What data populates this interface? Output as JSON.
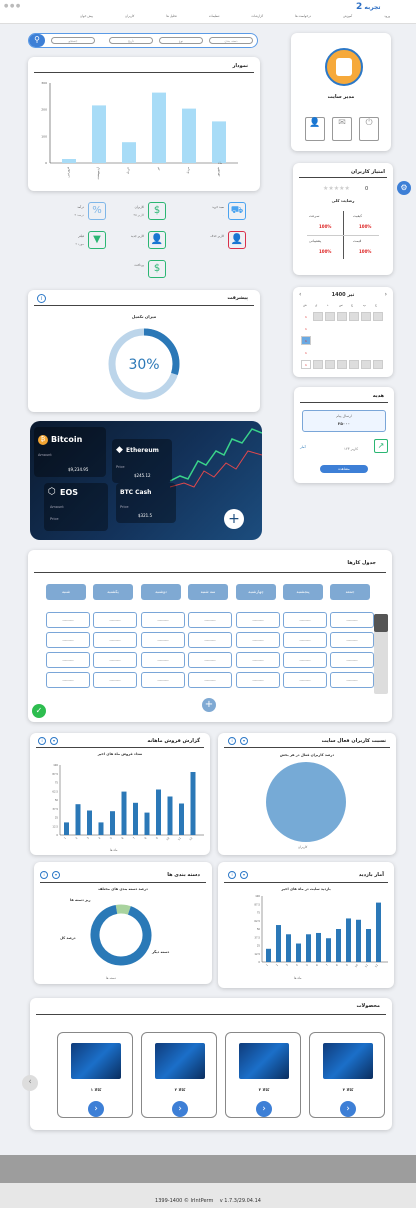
{
  "header": {
    "logo_text": "تجربه",
    "menu": [
      "پیش خوان",
      "کاربران",
      "تحلیل ها",
      "تنظیمات",
      "گزارشات",
      "درخواست ها",
      "آموزش",
      "ورود"
    ],
    "search_chips": [
      "جستجو",
      "تاریخ",
      "نوع",
      "دسته بندی"
    ]
  },
  "profile": {
    "name": "مدیر سایت",
    "actions": [
      "کاربر",
      "پیام",
      "خروج"
    ]
  },
  "bar_top": {
    "title": "نمودار",
    "xlabel": "ماه"
  },
  "stats": [
    {
      "label": "درآمد",
      "sub": "۴ درصد",
      "icon": "percent-icon"
    },
    {
      "label": "کاربران",
      "sub": "۳۵ کاربر",
      "icon": "dollar-icon"
    },
    {
      "label": "سبد خرید",
      "sub": "۰",
      "icon": "cart-icon"
    },
    {
      "label": "فیلتر",
      "sub": "۲ مورد",
      "icon": "filter-icon"
    },
    {
      "label": "کاربر جدید",
      "sub": "۰",
      "icon": "user-add-icon"
    },
    {
      "label": "کاربر حذف",
      "sub": "۰",
      "icon": "user-remove-icon"
    },
    {
      "label": "پرداخت",
      "sub": "۰",
      "icon": "money-icon"
    }
  ],
  "rating": {
    "title": "امتیاز کاربران",
    "score": "0",
    "subtitle": "رضایت کلی",
    "cols": [
      {
        "label": "سرعت",
        "value": "100%"
      },
      {
        "label": "کیفیت",
        "value": "100%"
      },
      {
        "label": "پشتیبانی",
        "value": "100%"
      },
      {
        "label": "قیمت",
        "value": "100%"
      }
    ]
  },
  "progress": {
    "title": "پیشرفت",
    "subtitle": "میزان تکمیل",
    "value": 0.3,
    "label": "30%"
  },
  "calendar": {
    "title": "1400 تیر",
    "days": [
      "ش",
      "ی",
      "د",
      "س",
      "چ",
      "پ",
      "ج"
    ]
  },
  "promo": {
    "title": "هدیه",
    "box_title": "ارسال پیام",
    "box_value": "۲۵۰۰۰",
    "side_a": "آمار",
    "side_b": "۱۲۳ کاربر",
    "button": "مشاهده"
  },
  "crypto": [
    {
      "name": "Bitcoin",
      "line1": "Amount",
      "line2": "$9,234.95"
    },
    {
      "name": "Ethereum",
      "line1": "Price",
      "line2": "$245.12"
    },
    {
      "name": "EOS",
      "line1": "Amount",
      "line2": "Price"
    },
    {
      "name": "BTC Cash",
      "line1": "Price",
      "line2": "$321.5"
    }
  ],
  "grid": {
    "title": "جدول کارها",
    "headers": [
      "شنبه",
      "یکشنبه",
      "دوشنبه",
      "سه شنبه",
      "چهارشنبه",
      "پنجشنبه",
      "جمعه"
    ],
    "cell_text": "---------"
  },
  "chart_a": {
    "title": "گزارش فروش ماهانه",
    "subtitle": "تعداد فروش ماه های اخیر",
    "xlabel": "ماه ها"
  },
  "chart_b": {
    "title": "نسبت کاربران فعال سایت",
    "subtitle": "درصد کاربران فعال در هر بخش",
    "xlabel": "کاربران"
  },
  "chart_c": {
    "title": "دسته بندی ها",
    "subtitle": "درصد دسته بندی های مختلف",
    "left_label": "درصد کل",
    "right_label": "دسته دیگر",
    "top_label": "ریز دسته ها",
    "xlabel": "دسته ها"
  },
  "chart_d": {
    "title": "آمار بازدید",
    "subtitle": "بازدید سایت در ماه های اخیر",
    "xlabel": "ماه ها"
  },
  "products": {
    "title": "محصولات",
    "items": [
      {
        "label": "۱ کالا"
      },
      {
        "label": "۲ کالا"
      },
      {
        "label": "۳ کالا"
      },
      {
        "label": "۴ کالا"
      }
    ]
  },
  "footer": {
    "text": "1399-1400 © IrIntPerm    v 1.7.3/29.04.14"
  },
  "chart_data": [
    {
      "type": "bar",
      "title": "نمودار",
      "categories": [
        "فروردین",
        "اردیبهشت",
        "خرداد",
        "تیر",
        "مرداد",
        "شهریور"
      ],
      "values": [
        5,
        72,
        26,
        88,
        68,
        52
      ],
      "ylim": [
        0,
        100
      ],
      "yticks": [
        "0",
        "100",
        "200",
        "300"
      ],
      "color": "#a8dcf7"
    },
    {
      "type": "bar",
      "title": "گزارش فروش ماهانه",
      "categories": [
        "1",
        "2",
        "3",
        "4",
        "5",
        "6",
        "7",
        "8",
        "9",
        "10",
        "11",
        "12"
      ],
      "values": [
        18,
        44,
        35,
        18,
        34,
        62,
        46,
        32,
        65,
        55,
        45,
        90
      ],
      "ylim": [
        0,
        100
      ],
      "color": "#2b78b7"
    },
    {
      "type": "pie",
      "title": "نسبت کاربران فعال سایت",
      "values": [
        100
      ],
      "colors": [
        "#76aad6"
      ]
    },
    {
      "type": "pie",
      "title": "دسته بندی ها",
      "values": [
        8,
        92
      ],
      "colors": [
        "#a9d39e",
        "#2a79b7"
      ]
    },
    {
      "type": "bar",
      "title": "آمار بازدید",
      "categories": [
        "1",
        "2",
        "3",
        "4",
        "5",
        "6",
        "7",
        "8",
        "9",
        "10",
        "11",
        "12"
      ],
      "values": [
        20,
        56,
        42,
        28,
        42,
        44,
        36,
        50,
        66,
        64,
        50,
        90
      ],
      "ylim": [
        0,
        100
      ],
      "color": "#2b78b7"
    }
  ]
}
